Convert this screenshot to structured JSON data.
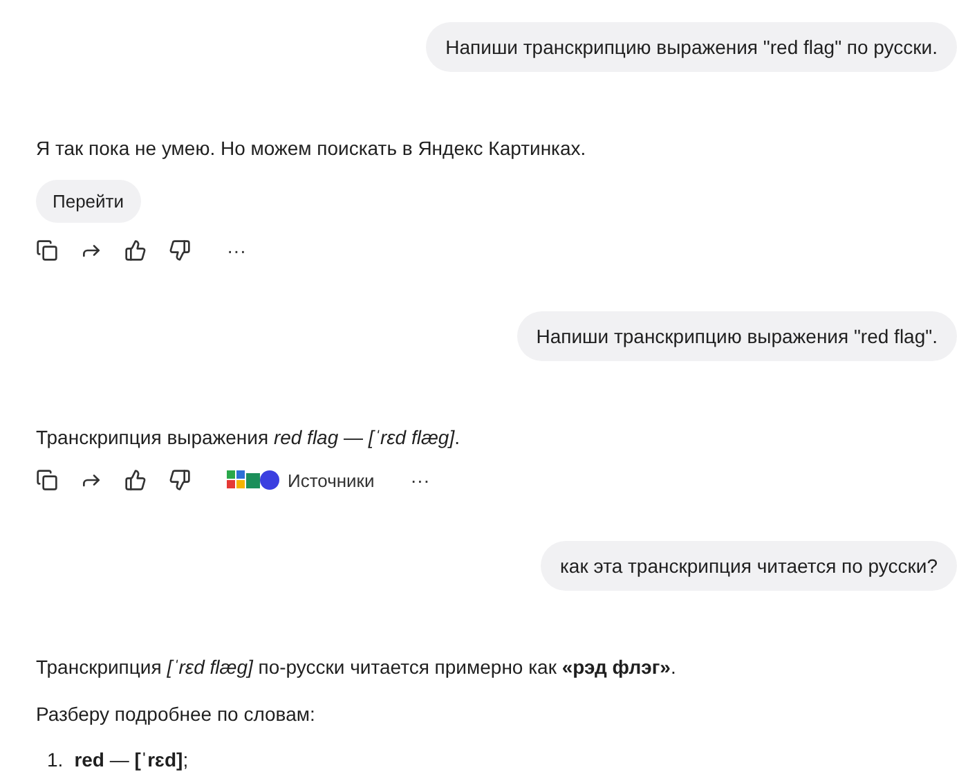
{
  "messages": [
    {
      "kind": "user",
      "text": "Напиши транскрипцию выражения \"red flag\" по русски."
    },
    {
      "kind": "assistant",
      "paragraphs": [
        "Я так пока не умею. Но можем поискать в Яндекс Картинках."
      ],
      "button": "Перейти",
      "actions": {
        "more": "···"
      }
    },
    {
      "kind": "user",
      "text": "Напиши транскрипцию выражения \"red flag\"."
    },
    {
      "kind": "assistant",
      "paragraphs": [
        "Транскрипция выражения *red flag* — *[ˈrɛd flæg]*."
      ],
      "actions": {
        "sources": "Источники",
        "more": "···"
      }
    },
    {
      "kind": "user",
      "text": "как эта транскрипция читается по русски?"
    },
    {
      "kind": "assistant",
      "paragraphs": [
        "Транскрипция *[ˈrɛd flæg]* по-русски читается примерно как **«рэд флэг»**.",
        "Разберу подробнее по словам:"
      ],
      "list": [
        {
          "number": "1.",
          "text": "**red** — **[ˈrɛd]**;"
        }
      ]
    }
  ]
}
